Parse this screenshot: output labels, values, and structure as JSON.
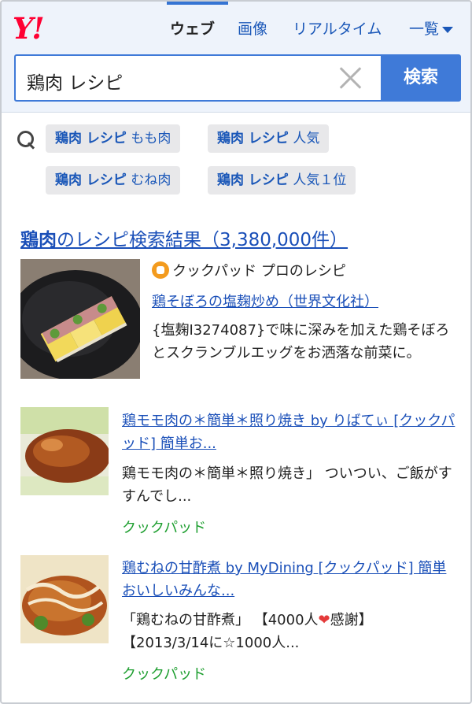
{
  "header": {
    "logo": "Y!",
    "tabs": [
      {
        "label": "ウェブ",
        "active": true
      },
      {
        "label": "画像",
        "active": false
      },
      {
        "label": "リアルタイム",
        "active": false
      },
      {
        "label": "一覧",
        "active": false
      }
    ]
  },
  "search": {
    "value": "鶏肉 レシピ",
    "button_label": "検索"
  },
  "suggestions": [
    {
      "bold": "鶏肉 レシピ",
      "rest": " もも肉"
    },
    {
      "bold": "鶏肉 レシピ",
      "rest": " 人気"
    },
    {
      "bold": "鶏肉 レシピ",
      "rest": " むね肉"
    },
    {
      "bold": "鶏肉 レシピ",
      "rest": " 人気１位"
    }
  ],
  "featured": {
    "title_bold": "鶏肉",
    "title_rest": "のレシピ検索結果（3,380,000件）",
    "source": "クックパッド プロのレシピ",
    "link": "鶏そぼろの塩麹炒め（世界文化社）",
    "snippet": "{塩麹I3274087}で味に深みを加えた鶏そぼろとスクランブルエッグをお洒落な前菜に。"
  },
  "results": [
    {
      "title": "鶏モモ肉の＊簡単＊照り焼き by りばてぃ [クックパッド] 簡単お...",
      "snippet": "鶏モモ肉の＊簡単＊照り焼き」 ついつい、ご飯がすすんでし...",
      "site": "クックパッド"
    },
    {
      "title": "鶏むねの甘酢煮 by MyDining [クックパッド] 簡単おいしいみんな...",
      "snippet_a": "「鶏むねの甘酢煮」 【4000人",
      "snippet_heart": "❤",
      "snippet_b": "感謝】 【2013/3/14に☆1000人...",
      "site": "クックパッド"
    }
  ],
  "colors": {
    "accent": "#3f7ad8",
    "link": "#1a4fb8",
    "site": "#1d9e2f",
    "logo": "#ff0033"
  }
}
